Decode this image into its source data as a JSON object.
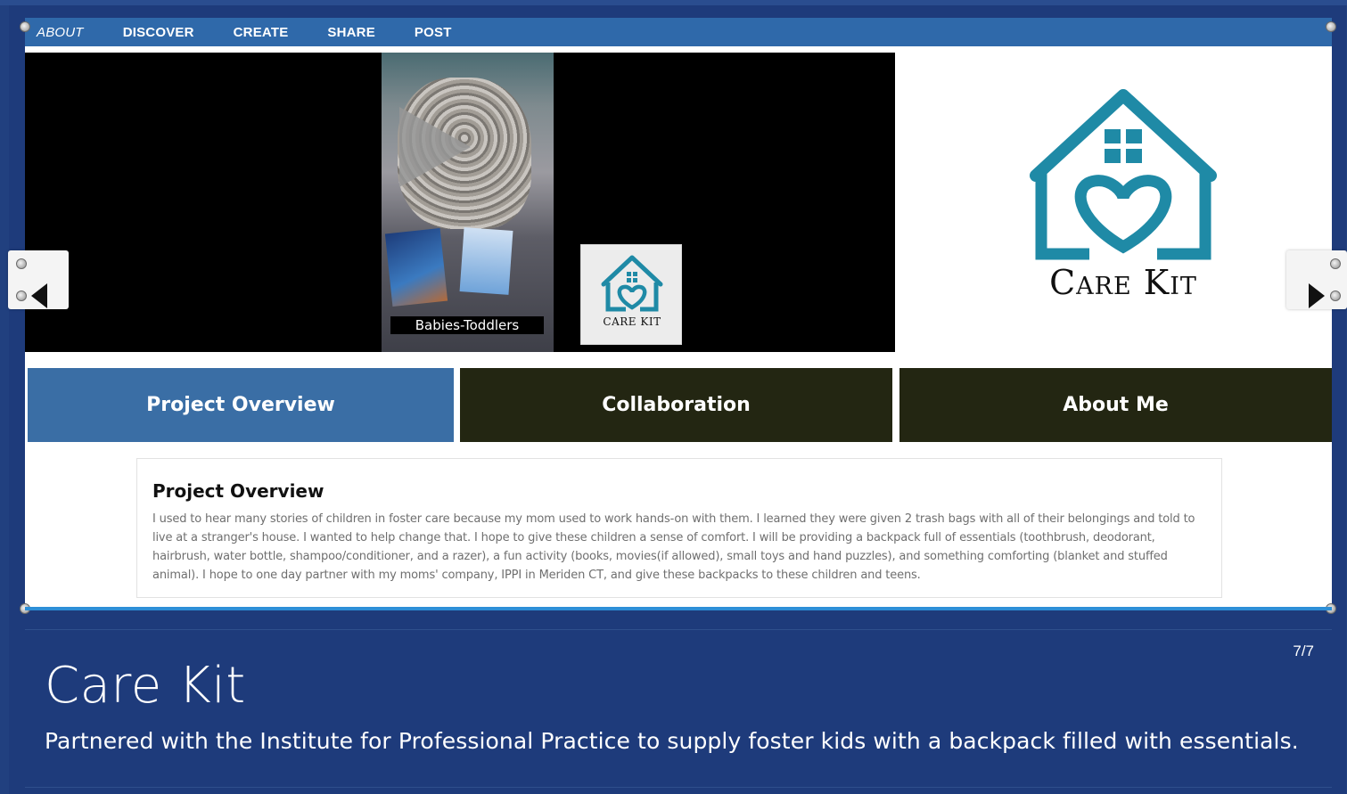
{
  "nav": {
    "items": [
      {
        "label": "ABOUT"
      },
      {
        "label": "DISCOVER"
      },
      {
        "label": "CREATE"
      },
      {
        "label": "SHARE"
      },
      {
        "label": "POST"
      }
    ]
  },
  "video": {
    "caption": "Babies-Toddlers",
    "overlay_logo_text": "Care Kit"
  },
  "logo": {
    "text": "Care Kit",
    "color": "#1f8aa6"
  },
  "tabs": [
    {
      "label": "Project Overview",
      "active": true
    },
    {
      "label": "Collaboration",
      "active": false
    },
    {
      "label": "About Me",
      "active": false
    }
  ],
  "overview": {
    "heading": "Project Overview",
    "body": "I used to hear many stories of children in foster care because my mom used to work hands-on with them. I learned they were given 2 trash bags with all of their belongings and told to live at a stranger's house. I wanted to help change that. I hope to give these children a sense of comfort. I will be providing a backpack full of essentials (toothbrush, deodorant, hairbrush, water bottle, shampoo/conditioner, and a razer), a fun activity (books, movies(if allowed), small toys and hand puzzles), and something comforting (blanket and stuffed animal). I hope to one day partner with my moms' company, IPPI in Meriden CT, and give these backpacks to these children and teens."
  },
  "project": {
    "counter": "7/7",
    "title": "Care Kit",
    "subtitle": "Partnered with the Institute for Professional Practice to supply foster kids with a backpack filled with essentials."
  },
  "colors": {
    "background": "#1e3b7b",
    "nav": "#2f69aa",
    "tab_active": "#3a6ea5",
    "tab_dark": "#232612",
    "accent_line": "#2d8fd7"
  }
}
